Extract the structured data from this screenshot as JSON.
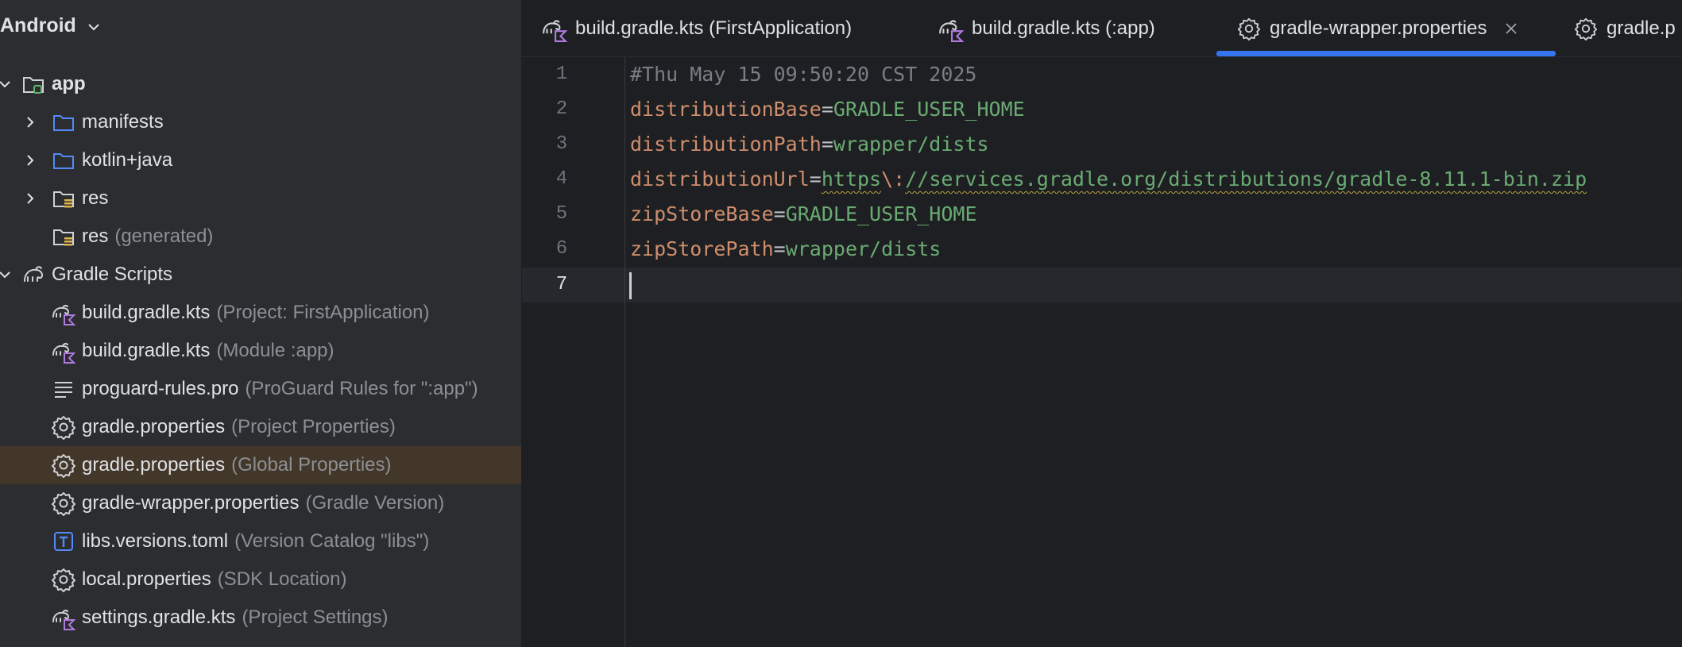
{
  "project_view": {
    "mode_label": "Android",
    "tree": [
      {
        "label": "app",
        "hint": "",
        "icon": "module-folder-icon",
        "expanded": true
      },
      {
        "label": "manifests",
        "hint": "",
        "icon": "folder-icon",
        "expanded": false
      },
      {
        "label": "kotlin+java",
        "hint": "",
        "icon": "folder-icon",
        "expanded": false
      },
      {
        "label": "res",
        "hint": "",
        "icon": "resource-folder-icon",
        "expanded": false
      },
      {
        "label": "res",
        "hint": "(generated)",
        "icon": "resource-folder-icon"
      },
      {
        "label": "Gradle Scripts",
        "hint": "",
        "icon": "gradle-elephant-icon",
        "expanded": true
      },
      {
        "label": "build.gradle.kts",
        "hint": "(Project: FirstApplication)",
        "icon": "gradle-kotlin-icon"
      },
      {
        "label": "build.gradle.kts",
        "hint": "(Module :app)",
        "icon": "gradle-kotlin-icon"
      },
      {
        "label": "proguard-rules.pro",
        "hint": "(ProGuard Rules for \":app\")",
        "icon": "text-file-icon"
      },
      {
        "label": "gradle.properties",
        "hint": "(Project Properties)",
        "icon": "gear-icon"
      },
      {
        "label": "gradle.properties",
        "hint": "(Global Properties)",
        "icon": "gear-icon",
        "selected": true
      },
      {
        "label": "gradle-wrapper.properties",
        "hint": "(Gradle Version)",
        "icon": "gear-icon"
      },
      {
        "label": "libs.versions.toml",
        "hint": "(Version Catalog \"libs\")",
        "icon": "toml-file-icon"
      },
      {
        "label": "local.properties",
        "hint": "(SDK Location)",
        "icon": "gear-icon"
      },
      {
        "label": "settings.gradle.kts",
        "hint": "(Project Settings)",
        "icon": "gradle-kotlin-icon"
      }
    ]
  },
  "tabs": [
    {
      "label": "build.gradle.kts (FirstApplication)",
      "icon": "gradle-kotlin-icon",
      "active": false
    },
    {
      "label": "build.gradle.kts (:app)",
      "icon": "gradle-kotlin-icon",
      "active": false
    },
    {
      "label": "gradle-wrapper.properties",
      "icon": "gear-icon",
      "active": true,
      "closable": true
    },
    {
      "label": "gradle.p",
      "icon": "gear-icon",
      "active": false
    }
  ],
  "editor": {
    "current_line": 7,
    "lines": [
      {
        "no": "1",
        "comment": "#Thu May 15 09:50:20 CST 2025"
      },
      {
        "no": "2",
        "key": "distributionBase",
        "eq": "=",
        "value": "GRADLE_USER_HOME"
      },
      {
        "no": "3",
        "key": "distributionPath",
        "eq": "=",
        "value": "wrapper/dists"
      },
      {
        "no": "4",
        "key": "distributionUrl",
        "eq": "=",
        "value_a": "https",
        "value_esc": "\\:",
        "value_b": "//services.gradle.org/distributions/gradle-8.11.1-bin.zip"
      },
      {
        "no": "5",
        "key": "zipStoreBase",
        "eq": "=",
        "value": "GRADLE_USER_HOME"
      },
      {
        "no": "6",
        "key": "zipStorePath",
        "eq": "=",
        "value": "wrapper/dists"
      },
      {
        "no": "7"
      }
    ]
  },
  "colors": {
    "sidebar_bg": "#2b2d30",
    "editor_bg": "#1e1f22",
    "selected_row": "#43372a",
    "accent": "#3574f0",
    "key": "#cf8e6d",
    "value": "#6aab73",
    "comment": "#7a7e85"
  }
}
